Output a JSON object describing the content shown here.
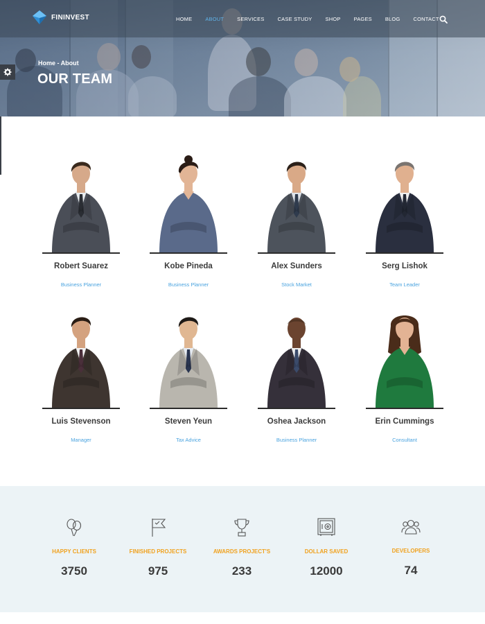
{
  "brand": {
    "name": "FININVEST",
    "accent": "#4aa3df",
    "stat_accent": "#f0a21f"
  },
  "nav": {
    "items": [
      {
        "label": "HOME",
        "active": false
      },
      {
        "label": "ABOUT",
        "active": true
      },
      {
        "label": "SERVICES",
        "active": false
      },
      {
        "label": "CASE STUDY",
        "active": false
      },
      {
        "label": "SHOP",
        "active": false
      },
      {
        "label": "PAGES",
        "active": false
      },
      {
        "label": "BLOG",
        "active": false
      },
      {
        "label": "CONTACT",
        "active": false
      }
    ],
    "search_icon": "search-icon"
  },
  "hero": {
    "breadcrumb": "Home - About",
    "title": "OUR TEAM"
  },
  "side": {
    "settings_icon": "gear-icon"
  },
  "team": [
    {
      "name": "Robert Suarez",
      "role": "Business Planner",
      "suit": "#4a4e57",
      "shirt": "#e8ecef",
      "tie": "#2a2d33",
      "skin": "#d6a98a",
      "hair": "#3a2a1e"
    },
    {
      "name": "Kobe Pineda",
      "role": "Business Planner",
      "suit": "#5a6a8a",
      "shirt": "#5a6a8a",
      "tie": "#5a6a8a",
      "skin": "#e2b596",
      "hair": "#2a1c16"
    },
    {
      "name": "Alex Sunders",
      "role": "Stock Market",
      "suit": "#4d535c",
      "shirt": "#dfe4ea",
      "tie": "#2f3b4d",
      "skin": "#d9a987",
      "hair": "#2b2019"
    },
    {
      "name": "Serg Lishok",
      "role": "Team Leader",
      "suit": "#2a2f3f",
      "shirt": "#f0f0f0",
      "tie": "#222733",
      "skin": "#e0b08f",
      "hair": "#7a7470"
    },
    {
      "name": "Luis Stevenson",
      "role": "Manager",
      "suit": "#3e3530",
      "shirt": "#f2f2f2",
      "tie": "#4a2f3a",
      "skin": "#d4a27f",
      "hair": "#2a1d15"
    },
    {
      "name": "Steven Yeun",
      "role": "Tax Advice",
      "suit": "#b9b6ae",
      "shirt": "#e6ebf2",
      "tie": "#2a3550",
      "skin": "#e0b792",
      "hair": "#1e1a17"
    },
    {
      "name": "Oshea Jackson",
      "role": "Business Planner",
      "suit": "#35303a",
      "shirt": "#eeeeee",
      "tie": "#3b4b6b",
      "skin": "#6b4430",
      "hair": "#3a2518"
    },
    {
      "name": "Erin Cummings",
      "role": "Consultant",
      "suit": "#1f7a3e",
      "shirt": "#1f7a3e",
      "tie": "#1f7a3e",
      "skin": "#e3b394",
      "hair": "#4a2c1a"
    }
  ],
  "stats": [
    {
      "label": "HAPPY CLIENTS",
      "value": "3750",
      "icon": "balloons-icon"
    },
    {
      "label": "FINISHED PROJECTS",
      "value": "975",
      "icon": "flag-icon"
    },
    {
      "label": "AWARDS PROJECT'S",
      "value": "233",
      "icon": "trophy-icon"
    },
    {
      "label": "DOLLAR SAVED",
      "value": "12000",
      "icon": "safe-icon"
    },
    {
      "label": "DEVELOPERS",
      "value": "74",
      "icon": "team-icon"
    }
  ]
}
